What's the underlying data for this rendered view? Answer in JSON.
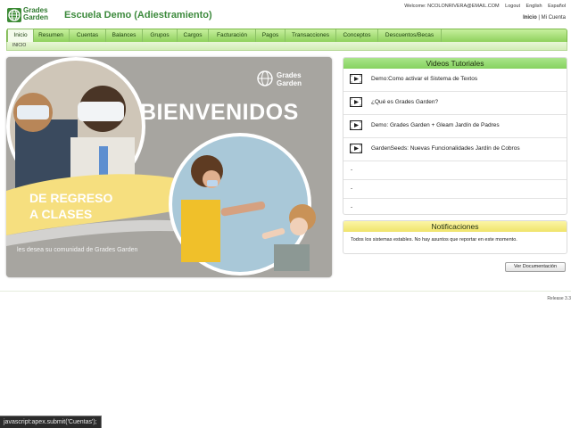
{
  "header": {
    "logo_line1": "Grades",
    "logo_line2": "Garden",
    "school_name": "Escuela Demo (Adiestramiento)",
    "welcome": "Welcome: NCOLONRIVERA@EMAIL.COM",
    "logout": "Logout",
    "lang_en": "English",
    "lang_es": "Español",
    "inicio_link": "Inicio",
    "separator": "|",
    "mi_cuenta": "Mi Cuenta"
  },
  "nav": {
    "tabs": [
      "Inicio",
      "Resumen",
      "Cuentas",
      "Balances",
      "Grupos",
      "Cargos",
      "Facturación",
      "Pagos",
      "Transacciones",
      "Conceptos",
      "Descuentos/Becas"
    ],
    "active": "Inicio",
    "breadcrumb": "INICIO"
  },
  "banner": {
    "logo_line1": "Grades",
    "logo_line2": "Garden",
    "title": "BIENVENIDOS",
    "line1": "DE REGRESO",
    "line2": "A CLASES",
    "subtitle": "les desea su comunidad de Grades Garden",
    "colors": {
      "background": "#a7a5a0",
      "ribbon": "#f6df7f"
    }
  },
  "videos": {
    "title": "Videos Tutoriales",
    "items": [
      "Demo:Como activar el Sistema de Textos",
      "¿Qué es Grades Garden?",
      "Demo: Grades Garden + Gleam Jardín de Padres",
      "GardenSeeds: Nuevas Funcionalidades Jardín de Cobros"
    ],
    "placeholders": [
      "-",
      "-",
      "-"
    ]
  },
  "notifications": {
    "title": "Notificaciones",
    "text": "Todos los sistemas estables. No hay asuntos que reportar en este momento."
  },
  "doc_button": "Ver Documentación",
  "release": "Release 3.3",
  "statusbar": "javascript:apex.submit('Cuentas');",
  "colors": {
    "nav_green": "#8fd15d",
    "title_green": "#3d8a3d",
    "notif_yellow": "#f0e46b"
  }
}
